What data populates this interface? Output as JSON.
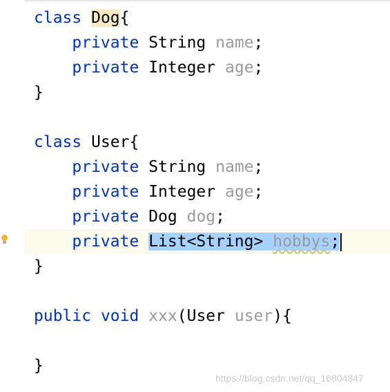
{
  "code": {
    "line1": {
      "kw": "class",
      "name": "Dog",
      "brace": "{"
    },
    "line2": {
      "kw": "private",
      "type": "String",
      "field": "name",
      "end": ";"
    },
    "line3": {
      "kw": "private",
      "type": "Integer",
      "field": "age",
      "end": ";"
    },
    "line4": {
      "text": "}"
    },
    "line6": {
      "kw": "class",
      "name": "User{"
    },
    "line7": {
      "kw": "private",
      "type": "String",
      "field": "name",
      "end": ";"
    },
    "line8": {
      "kw": "private",
      "type": "Integer",
      "field": "age",
      "end": ";"
    },
    "line9": {
      "kw": "private",
      "type": "Dog",
      "field": "dog",
      "end": ";"
    },
    "line10": {
      "kw": "private",
      "type": "List<String>",
      "field": "hobbys",
      "end": ";"
    },
    "line11": {
      "text": "}"
    },
    "line13": {
      "kw1": "public",
      "kw2": "void",
      "method": "xxx",
      "paren_open": "(",
      "ptype": "User",
      "pname": "user",
      "paren_close": "){"
    },
    "line15": {
      "text": "}"
    }
  },
  "watermark": "https://blog.csdn.net/qq_16804847",
  "colors": {
    "keyword": "#0033b3",
    "muted": "#9a9a9a",
    "selection": "#a6d2ff",
    "current_line": "#fcfaed"
  },
  "icons": {
    "gutter": "lightbulb-icon"
  }
}
